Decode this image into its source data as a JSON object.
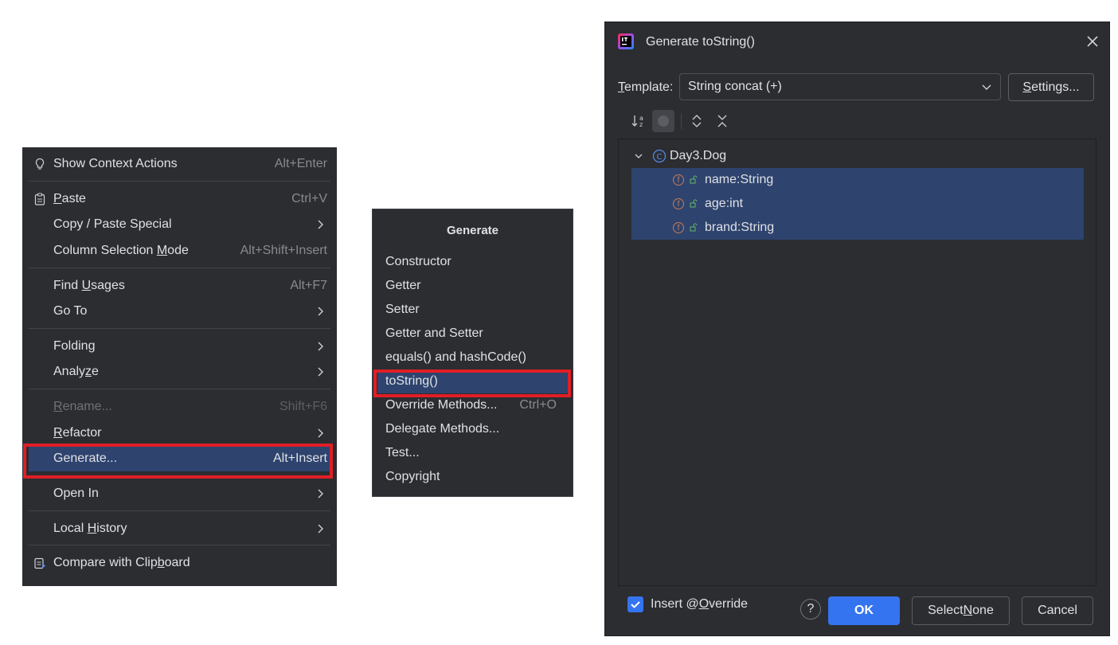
{
  "context_menu": {
    "items": [
      {
        "label": "Show Context Actions",
        "shortcut": "Alt+Enter",
        "icon": "lightbulb-icon"
      },
      {
        "label_parts": [
          "",
          "P",
          "aste"
        ],
        "shortcut": "Ctrl+V",
        "icon": "clipboard-icon"
      },
      {
        "label": "Copy / Paste Special"
      },
      {
        "label_parts": [
          "Column Selection ",
          "M",
          "ode"
        ],
        "shortcut": "Alt+Shift+Insert"
      },
      {
        "label_parts": [
          "Find ",
          "U",
          "sages"
        ],
        "shortcut": "Alt+F7"
      },
      {
        "label": "Go To"
      },
      {
        "label": "Folding"
      },
      {
        "label_parts": [
          "Analy",
          "z",
          "e"
        ]
      },
      {
        "label_parts": [
          "",
          "R",
          "ename..."
        ],
        "shortcut": "Shift+F6",
        "disabled": true
      },
      {
        "label_parts": [
          "",
          "R",
          "efactor"
        ]
      },
      {
        "label": "Generate...",
        "shortcut": "Alt+Insert",
        "selected": true
      },
      {
        "label": "Open In"
      },
      {
        "label_parts": [
          "Local ",
          "H",
          "istory"
        ]
      },
      {
        "label_parts": [
          "Compare with Clip",
          "b",
          "oard"
        ],
        "icon": "compare-clipboard-icon"
      }
    ]
  },
  "generate_popup": {
    "title": "Generate",
    "items": [
      {
        "label": "Constructor"
      },
      {
        "label": "Getter"
      },
      {
        "label": "Setter"
      },
      {
        "label": "Getter and Setter"
      },
      {
        "label": "equals() and hashCode()"
      },
      {
        "label": "toString()",
        "selected": true
      },
      {
        "label": "Override Methods...",
        "shortcut": "Ctrl+O"
      },
      {
        "label": "Delegate Methods..."
      },
      {
        "label": "Test..."
      },
      {
        "label": "Copyright"
      }
    ]
  },
  "dialog": {
    "title": "Generate toString()",
    "template_label_u": "T",
    "template_label_rest": "emplate:",
    "template_value": "String concat (+)",
    "settings_u": "S",
    "settings_rest": "ettings...",
    "tree": {
      "class_name": "Day3.Dog",
      "fields": [
        "name:String",
        "age:int",
        "brand:String"
      ]
    },
    "insert_override_pre": "Insert @",
    "insert_override_u": "O",
    "insert_override_post": "verride",
    "insert_override_checked": true,
    "ok_label": "OK",
    "select_none_pre": "Select ",
    "select_none_u": "N",
    "select_none_post": "one",
    "cancel_label": "Cancel",
    "help_label": "?"
  },
  "colors": {
    "menu_bg": "#2b2d30",
    "selection": "#2e436e",
    "highlight_border": "#e01e26",
    "primary_button": "#3574f0"
  }
}
